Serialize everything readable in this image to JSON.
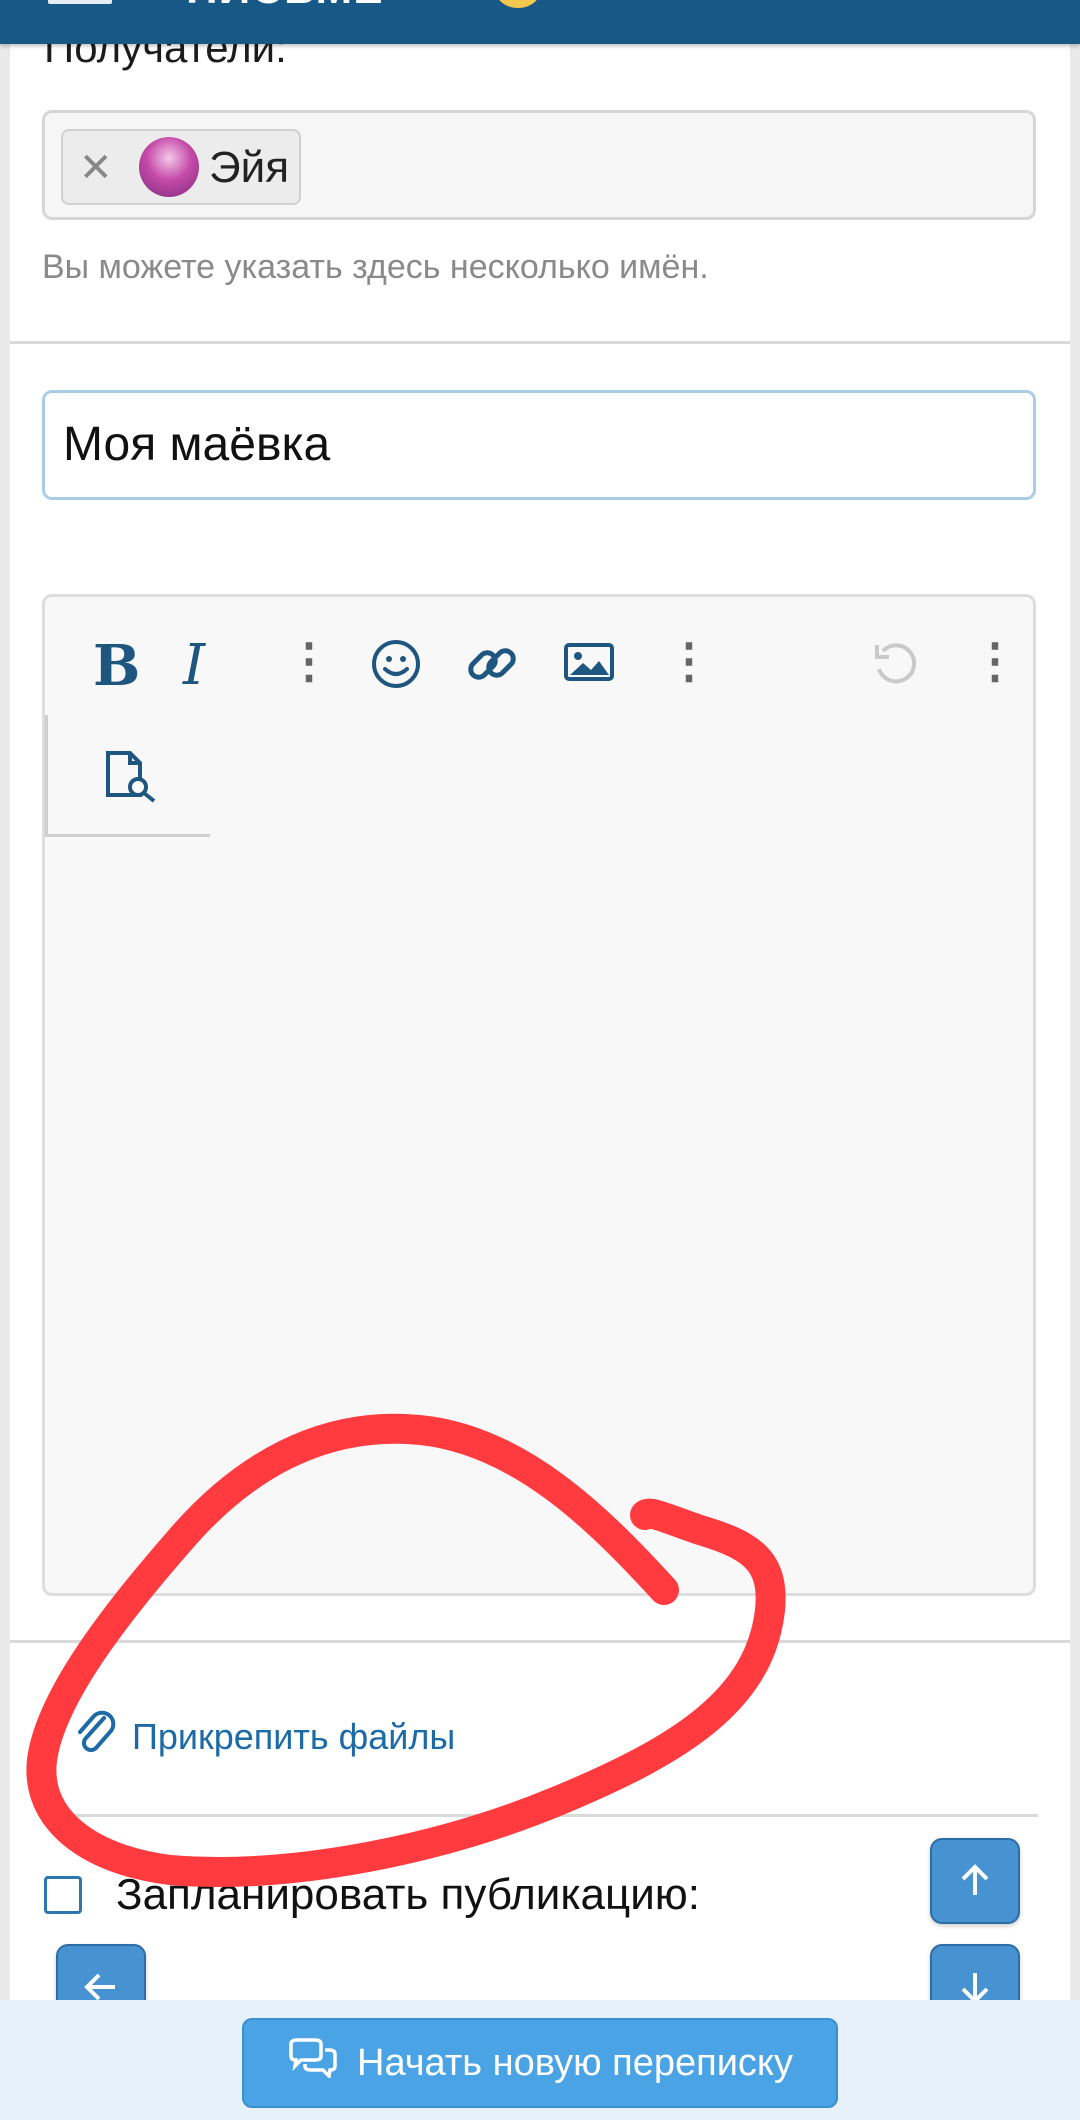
{
  "header": {
    "title": "ПИСЬМЕ"
  },
  "recipients": {
    "label": "Получатели:",
    "chips": [
      {
        "name": "Эйя",
        "remove_icon": "close-icon",
        "avatar": "avatar"
      }
    ],
    "hint": "Вы можете указать здесь несколько имён."
  },
  "title_field": {
    "value": "Моя маёвка"
  },
  "toolbar": {
    "bold_label": "B",
    "italic_label": "I",
    "icons": [
      "more-vertical-icon",
      "smile-icon",
      "link-icon",
      "image-icon",
      "more-vertical-icon",
      "undo-icon",
      "more-vertical-icon",
      "preview-icon"
    ]
  },
  "attach": {
    "label": "Прикрепить файлы",
    "icon": "paperclip-icon"
  },
  "schedule": {
    "label": "Запланировать публикацию:"
  },
  "nav": {
    "up_icon": "arrow-up-icon",
    "down_icon": "arrow-down-icon",
    "back_icon": "arrow-left-icon"
  },
  "submit": {
    "label": "Начать новую переписку",
    "icon": "chat-bubbles-icon"
  },
  "colors": {
    "topbar": "#185886",
    "accent": "#1c6aa6",
    "button": "#4aa3e4",
    "annotation": "#ff3b3f"
  }
}
